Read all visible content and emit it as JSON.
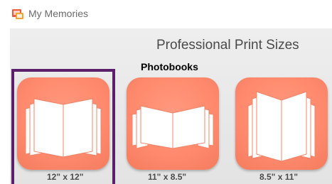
{
  "window": {
    "title": "My Memories",
    "icon": "my-memories-app-icon"
  },
  "main": {
    "heading": "Professional Print Sizes",
    "subheading": "Photobooks",
    "selected_index": 0,
    "accent_color": "#ff8a6d",
    "selection_color": "#5b1f6b",
    "options": [
      {
        "label": "12\" x 12\"",
        "icon": "open-book-icon"
      },
      {
        "label": "11\" x 8.5\"",
        "icon": "open-book-icon"
      },
      {
        "label": "8.5\" x 11\"",
        "icon": "open-book-icon"
      }
    ]
  }
}
